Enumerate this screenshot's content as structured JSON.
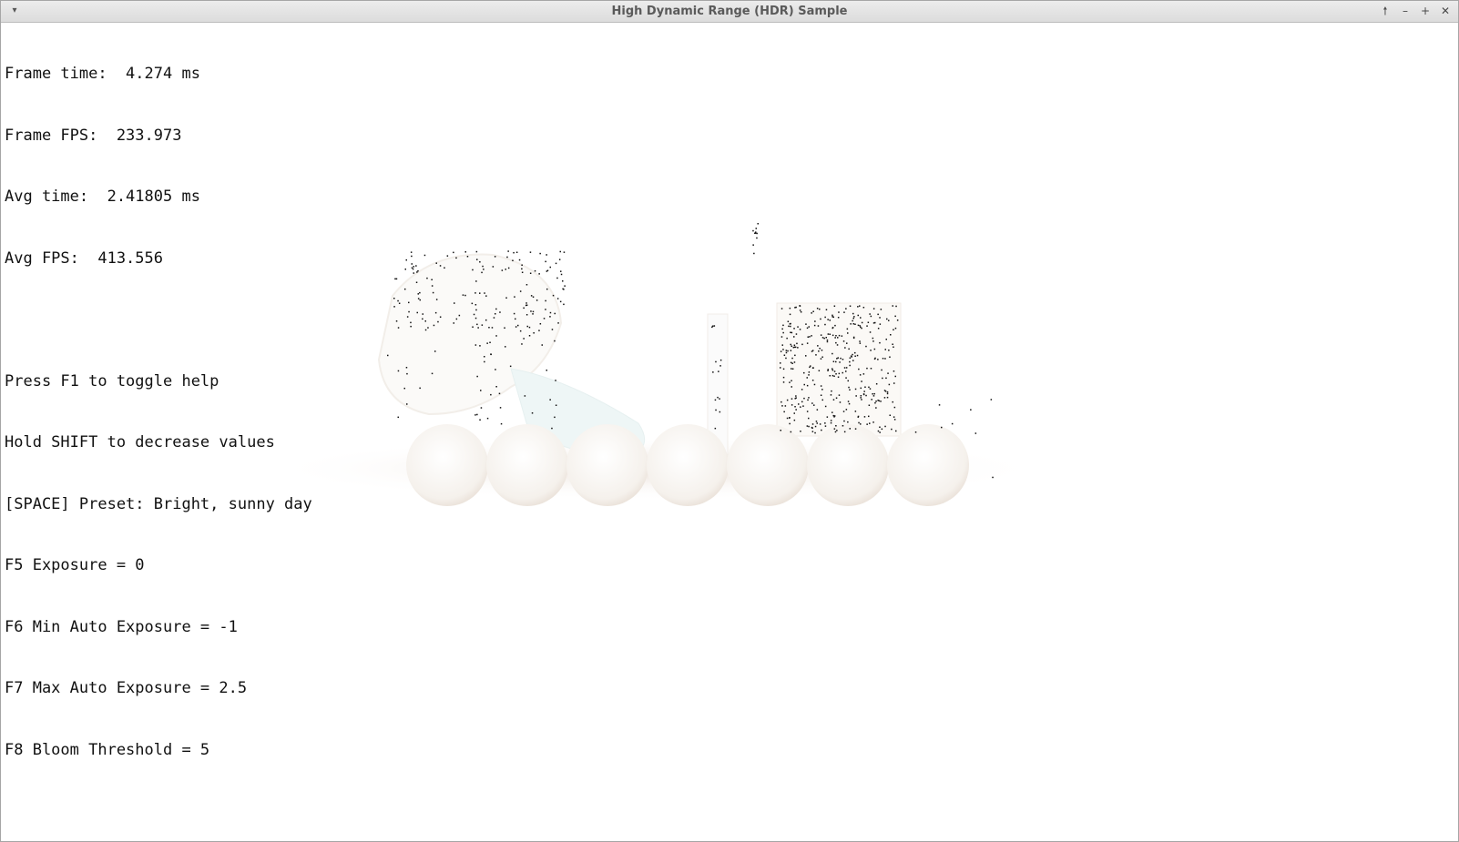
{
  "window": {
    "title": "High Dynamic Range (HDR) Sample",
    "buttons": {
      "menu": "▾",
      "raise": "🠕",
      "minimize": "–",
      "maximize": "+",
      "close": "✕"
    }
  },
  "hud": {
    "stats": [
      "Frame time:  4.274 ms",
      "Frame FPS:  233.973",
      "Avg time:  2.41805 ms",
      "Avg FPS:  413.556"
    ],
    "help": [
      "Press F1 to toggle help",
      "Hold SHIFT to decrease values",
      "[SPACE] Preset: Bright, sunny day",
      "F5 Exposure = 0",
      "F6 Min Auto Exposure = -1",
      "F7 Max Auto Exposure = 2.5",
      "F8 Bloom Threshold = 5"
    ]
  },
  "scene": {
    "background_color": "#ffffff",
    "object_color": "#f6f3ef",
    "shadow_color": "#ece2da",
    "artifact_color": "#111111"
  }
}
